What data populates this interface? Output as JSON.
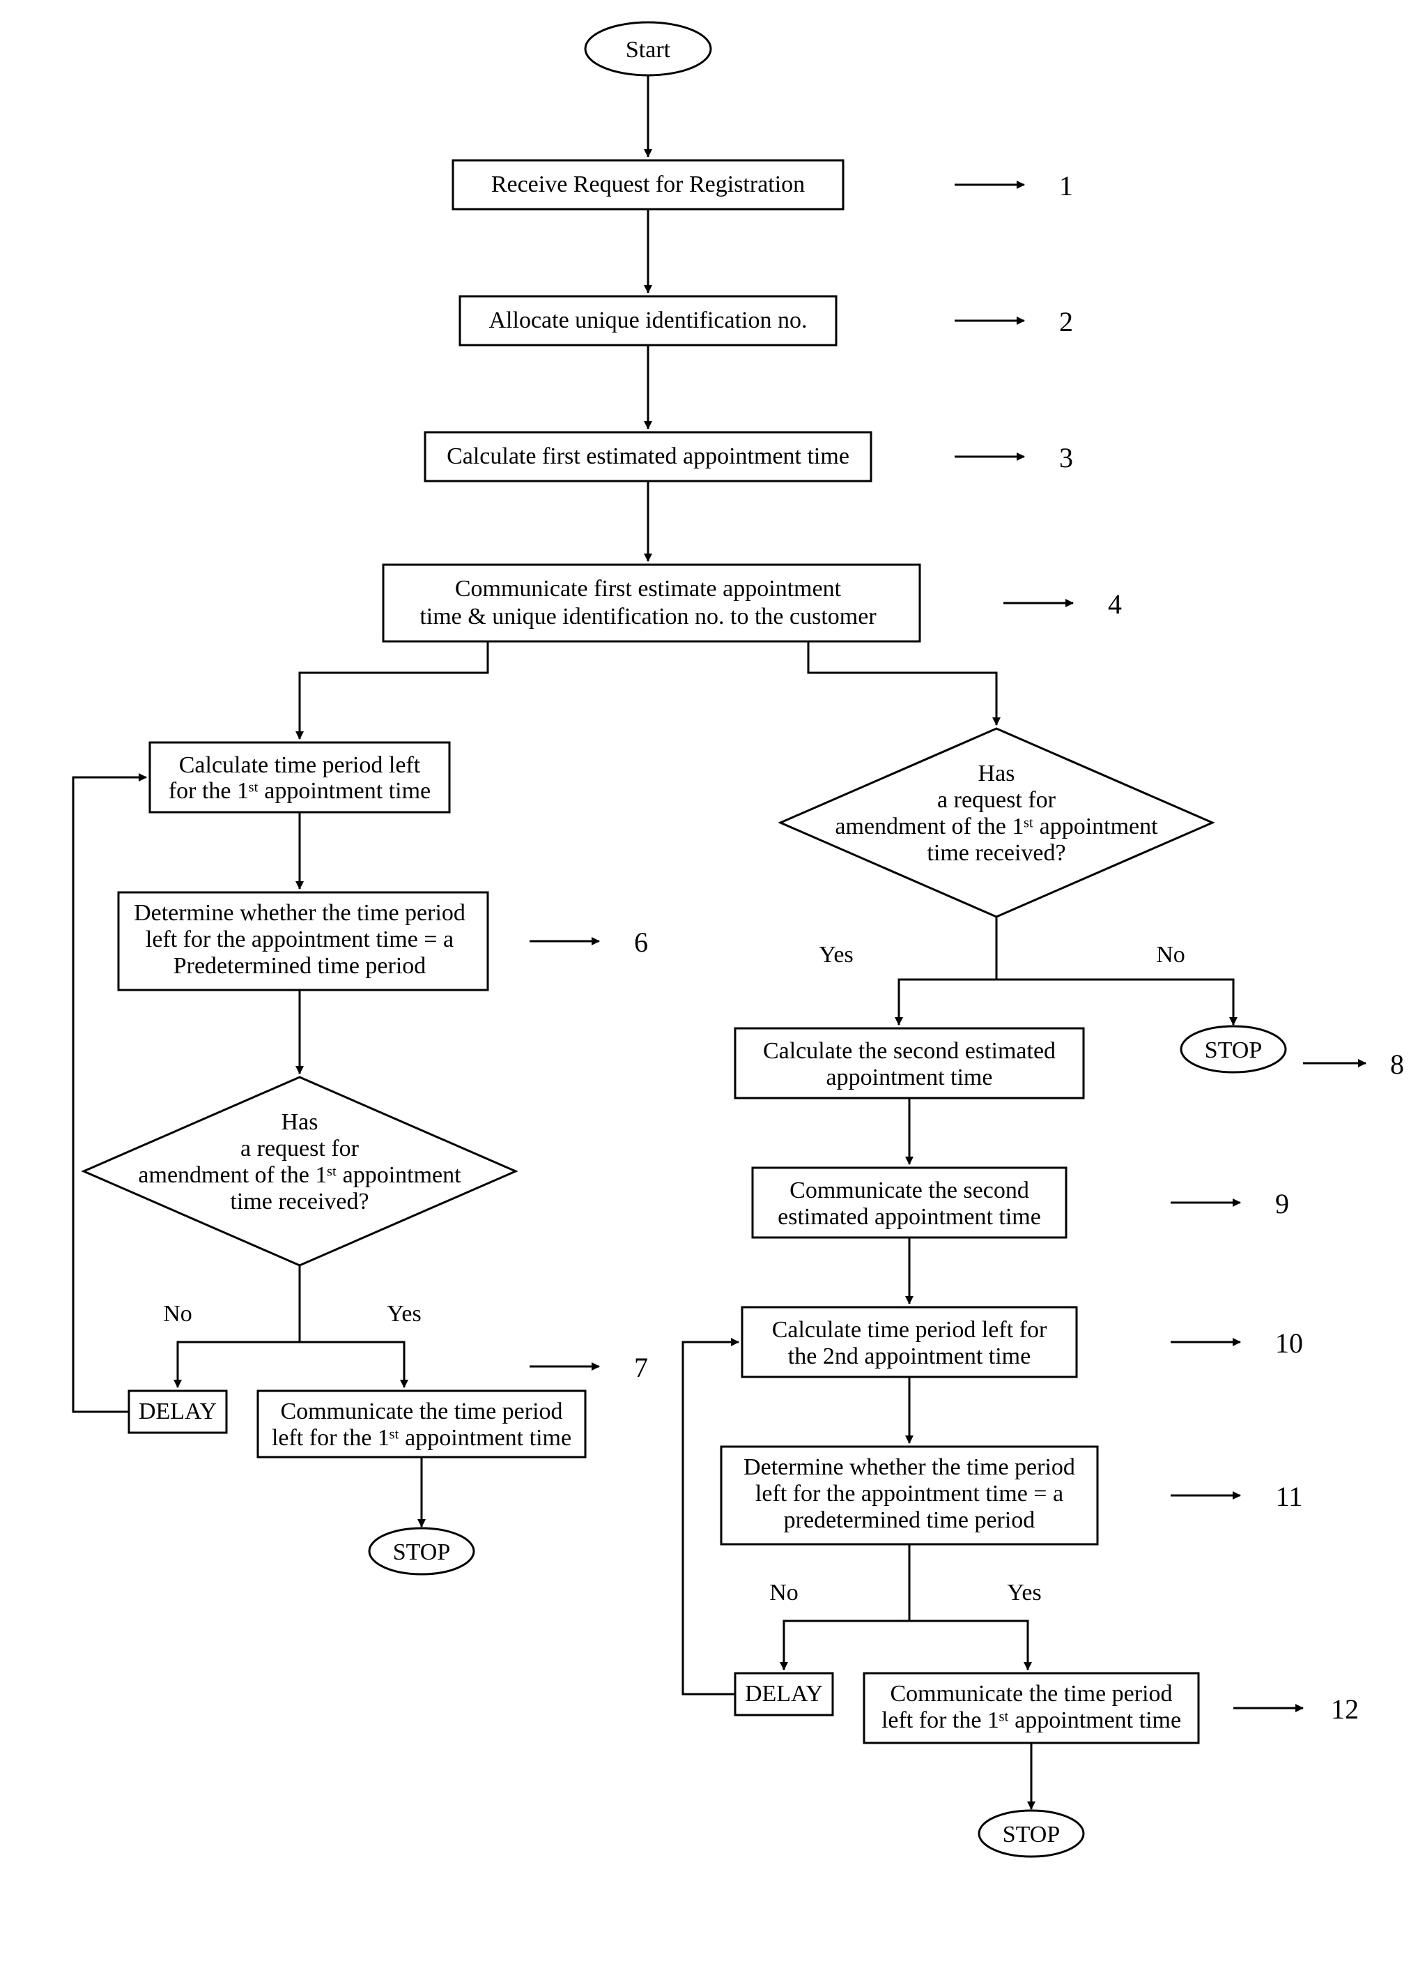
{
  "steps": {
    "start": "Start",
    "s1": "Receive Request for Registration",
    "s2": "Allocate unique identification no.",
    "s3": "Calculate first estimated appointment time",
    "s4a": "Communicate first estimate appointment",
    "s4b": "time & unique identification no. to the customer",
    "l5a": "Calculate time period left",
    "l5b": "for the 1ˢᵗ appointment time",
    "l6a": "Determine whether the time period",
    "l6b": "left for the appointment time = a",
    "l6c": "Predetermined time period",
    "ld1": "Has",
    "ld2": "a request for",
    "ld3": "amendment of the 1ˢᵗ appointment",
    "ld4": "time received?",
    "l7a": "Communicate the time period",
    "l7b": "left for the 1ˢᵗ appointment time",
    "rd1": "Has",
    "rd2": "a request for",
    "rd3": "amendment of the 1ˢᵗ appointment",
    "rd4": "time received?",
    "r8a": "Calculate the second estimated",
    "r8b": "appointment time",
    "r9a": "Communicate the second",
    "r9b": "estimated appointment time",
    "r10a": "Calculate time period left for",
    "r10b": "the 2nd appointment time",
    "r11a": "Determine whether the time period",
    "r11b": "left for the appointment time = a",
    "r11c": "predetermined time period",
    "r12a": "Communicate the time period",
    "r12b": "left for the 1ˢᵗ appointment time",
    "delay": "DELAY",
    "stop": "STOP",
    "yes": "Yes",
    "no": "No"
  },
  "nums": {
    "n1": "1",
    "n2": "2",
    "n3": "3",
    "n4": "4",
    "n6": "6",
    "n7": "7",
    "n8": "8",
    "n9": "9",
    "n10": "10",
    "n11": "11",
    "n12": "12"
  }
}
